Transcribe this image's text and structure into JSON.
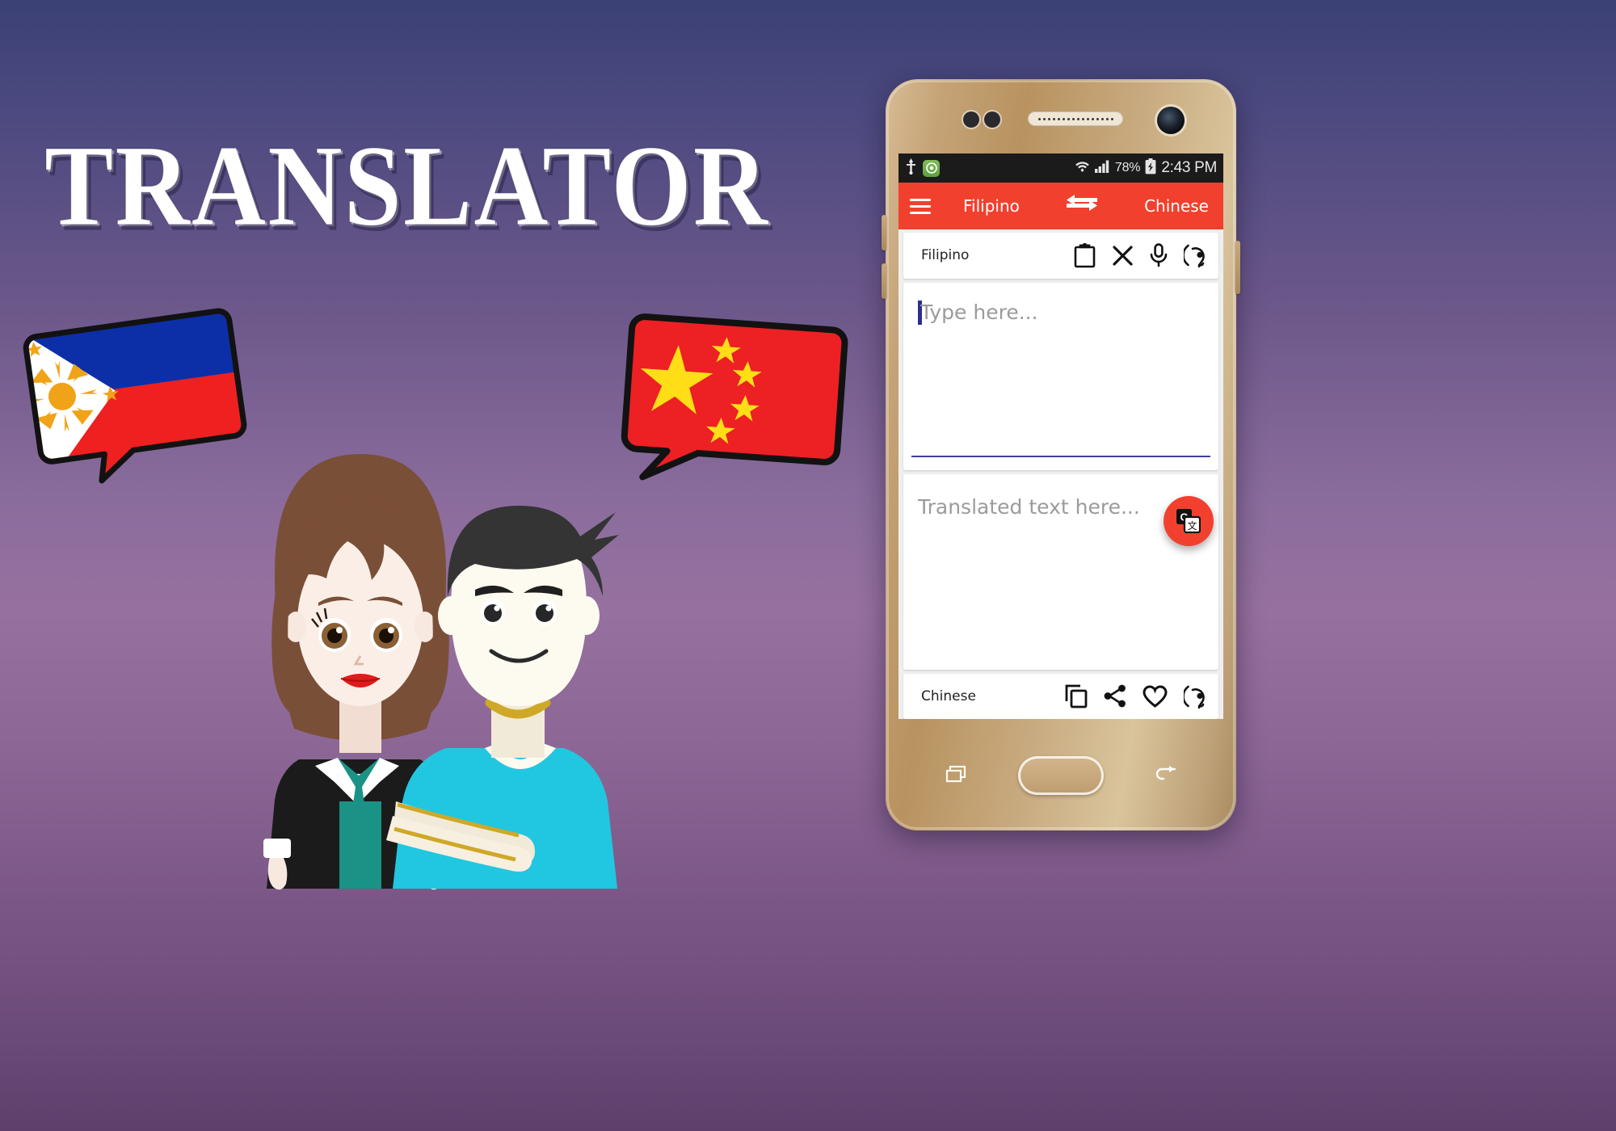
{
  "page": {
    "title": "TRANSLATOR",
    "background_top": "#3b4074",
    "background_mid": "#96719f",
    "background_bottom": "#5e3f6c"
  },
  "bubbles": {
    "left": {
      "name": "philippines-flag-bubble",
      "country": "Philippines",
      "colors": {
        "blue": "#0c2fa8",
        "red": "#ef2020",
        "white": "#ffffff",
        "sun": "#f0a318"
      }
    },
    "right": {
      "name": "china-flag-bubble",
      "country": "China",
      "colors": {
        "red": "#ed2024",
        "star": "#ffde17"
      }
    }
  },
  "characters": {
    "woman": {
      "hair": "#7a4f38",
      "skin": "#f7e8e0",
      "jacket": "#1b1b1b",
      "dress": "#1a9285",
      "lips": "#e01b1b"
    },
    "man": {
      "hair": "#343434",
      "skin": "#fdfbf0",
      "shirt": "#21c7e0",
      "necklace": "#cfa827"
    }
  },
  "phone": {
    "frame_color": "#c5a377",
    "statusbar": {
      "usb_icon": "usb-icon",
      "app_icon": "app-notification-icon",
      "wifi_icon": "wifi-icon",
      "signal_icon": "cellular-signal-icon",
      "battery_percent": "78%",
      "battery_icon": "battery-charging-icon",
      "time": "2:43 PM"
    },
    "appbar": {
      "menu_icon": "hamburger-menu-icon",
      "source_language": "Filipino",
      "swap_icon": "swap-languages-icon",
      "target_language": "Chinese",
      "background": "#f2402f"
    },
    "source_toolbar": {
      "label": "Filipino",
      "icons": [
        "paste-clipboard-icon",
        "clear-close-icon",
        "microphone-icon",
        "listen-speak-icon"
      ]
    },
    "input": {
      "placeholder": "Type here...",
      "value": "",
      "cursor_color": "#2b2f8f",
      "underline_color": "#3c3f9c"
    },
    "fab": {
      "name": "translate-button",
      "icon": "google-translate-icon",
      "color": "#f2402f"
    },
    "output": {
      "placeholder": "Translated text here...",
      "value": ""
    },
    "target_toolbar": {
      "label": "Chinese",
      "icons": [
        "copy-icon",
        "share-icon",
        "favorite-heart-icon",
        "listen-speak-icon"
      ]
    },
    "navbar": {
      "recents_icon": "recent-apps-icon",
      "home_button": "home-button",
      "back_icon": "back-icon"
    }
  }
}
